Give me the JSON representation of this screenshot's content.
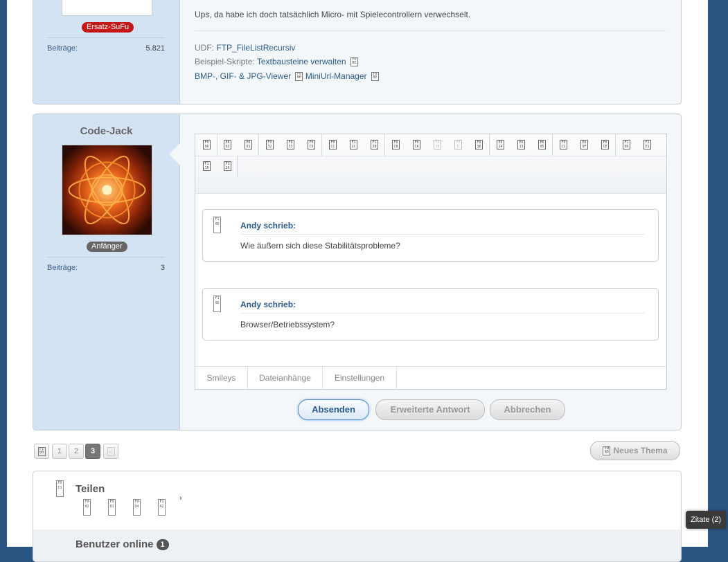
{
  "post1": {
    "rank": "Ersatz-SuFu",
    "stat_label": "Beiträge:",
    "stat_value": "5.821",
    "message": "Ups, da habe ich doch tatsächlich Micro- mit Spielecontrollern verwechselt.",
    "sig_udf_label": "UDF:",
    "sig_udf_link": "FTP_FileListRecursiv",
    "sig_scripts_label": "Beispiel-Skripte:",
    "sig_link_1": "Textbausteine verwalten",
    "sig_link_2": "BMP-, GIF- & JPG-Viewer",
    "sig_link_3": "MiniUrl-Manager"
  },
  "post2": {
    "username": "Code-Jack",
    "rank": "Anfänger",
    "stat_label": "Beiträge:",
    "stat_value": "3",
    "quotes": [
      {
        "author": "Andy schrieb:",
        "text": "Wie äußern sich diese Stabilitätsprobleme?"
      },
      {
        "author": "Andy schrieb:",
        "text": "Browser/Betriebssystem?"
      }
    ],
    "tabs": [
      "Smileys",
      "Dateianhänge",
      "Einstellungen"
    ],
    "buttons": {
      "submit": "Absenden",
      "advanced": "Erweiterte Antwort",
      "cancel": "Abbrechen"
    }
  },
  "pagination": {
    "pages": [
      "1",
      "2",
      "3"
    ],
    "current": "3"
  },
  "new_thread": "Neues Thema",
  "share": {
    "title": "Teilen",
    "online_title": "Benutzer online",
    "online_count": "1",
    "chevron": "›"
  },
  "tooltip": "Zitate (2)"
}
